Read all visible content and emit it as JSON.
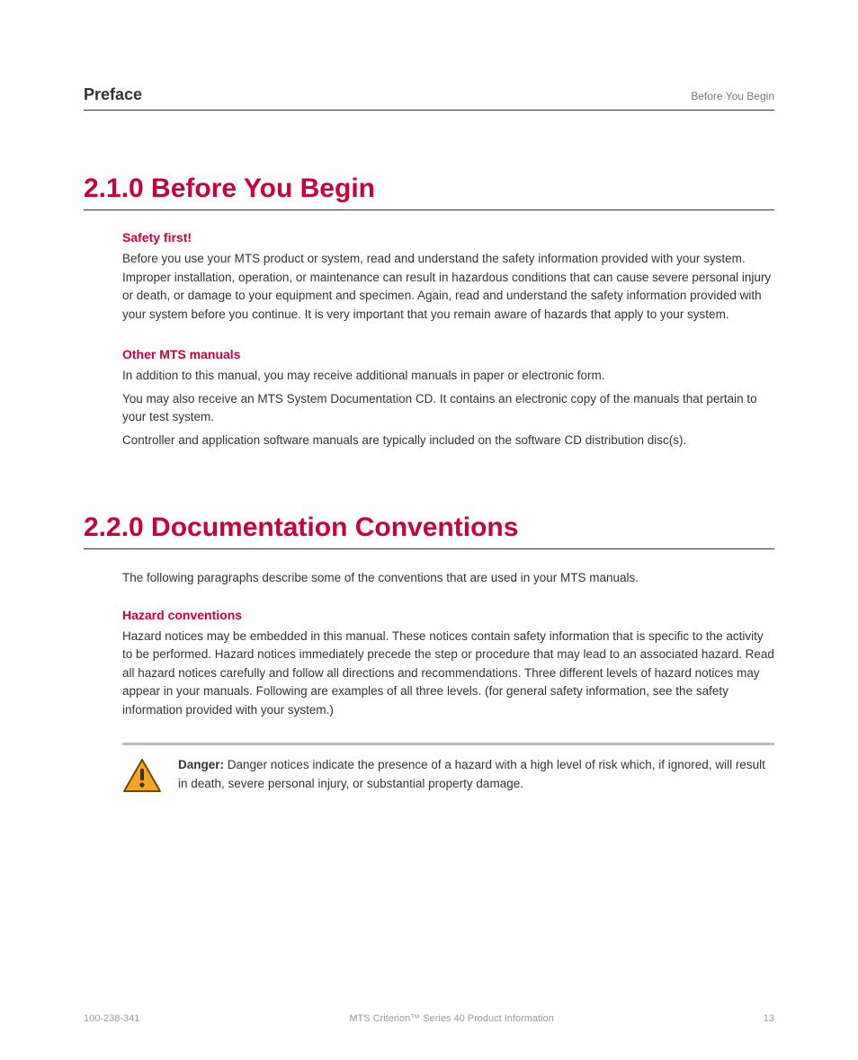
{
  "header": {
    "title": "Preface",
    "right": "Before You Begin"
  },
  "section1": {
    "heading": "2.1.0 Before You Begin",
    "safety": {
      "heading": "Safety first!",
      "p1": "Before you use your MTS product or system, read and understand the safety information provided with your system. Improper installation, operation, or maintenance can result in hazardous conditions that can cause severe personal injury or death, or damage to your equipment and specimen. Again, read and understand the safety information provided with your system before you continue. It is very important that you remain aware of hazards that apply to your system."
    },
    "manuals": {
      "heading": "Other MTS manuals",
      "p1": "In addition to this manual, you may receive additional manuals in paper or electronic form.",
      "p2": "You may also receive an MTS System Documentation CD. It contains an electronic copy of the manuals that pertain to your test system.",
      "p3": "Controller and application software manuals are typically included on the software CD distribution disc(s)."
    }
  },
  "section2": {
    "heading": "2.2.0 Documentation Conventions",
    "intro": "The following paragraphs describe some of the conventions that are used in your MTS manuals.",
    "hazard": {
      "heading": "Hazard conventions",
      "p1": "Hazard notices may be embedded in this manual. These notices contain safety information that is specific to the activity to be performed. Hazard notices immediately precede the step or procedure that may lead to an associated hazard. Read all hazard notices carefully and follow all directions and recommendations. Three different levels of hazard notices may appear in your manuals. Following are examples of all three levels. (for general safety information, see the safety information provided with your system.)",
      "danger_bold": "Danger:",
      "danger_text": " Danger notices indicate the presence of a hazard with a high level of risk which, if ignored, will result in death, severe personal injury, or substantial property damage."
    }
  },
  "footer": {
    "left": "100-238-341",
    "center": "MTS Criterion™ Series 40 Product Information",
    "right": "13"
  }
}
